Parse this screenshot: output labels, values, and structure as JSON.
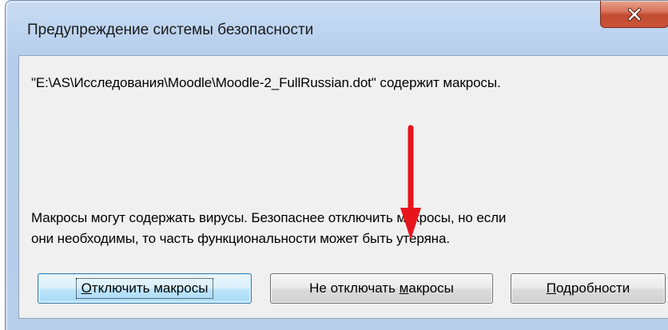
{
  "window": {
    "title": "Предупреждение системы безопасности",
    "close_label": "X"
  },
  "message": {
    "macro_notice": "\"E:\\AS\\Исследования\\Moodle\\Moodle-2_FullRussian.dot\" содержит макросы.",
    "warning_line1": "Макросы могут содержать вирусы. Безопаснее отключить макросы, но если",
    "warning_line2": "они необходимы, то часть функциональности может быть утеряна."
  },
  "buttons": {
    "disable": {
      "prefix": "",
      "mnemonic": "О",
      "suffix": "тключить макросы"
    },
    "keep": {
      "prefix": "Не отключать ",
      "mnemonic": "м",
      "suffix": "акросы"
    },
    "details": {
      "prefix": "",
      "mnemonic": "П",
      "suffix": "одробности"
    }
  },
  "colors": {
    "annotation_arrow": "#e8141c",
    "close_button": "#c24a30",
    "titlebar": "#c9dcf3",
    "dialog_body": "#f0f0f0"
  },
  "icons": {
    "close": "close-icon",
    "annotation": "red-arrow-annotation"
  }
}
